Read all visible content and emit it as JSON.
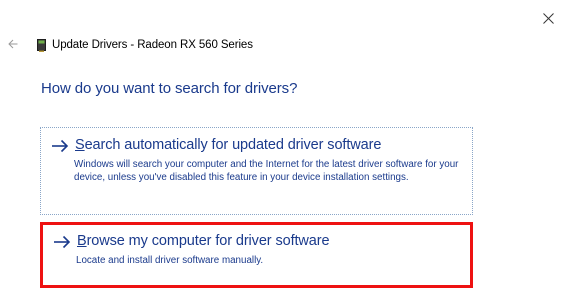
{
  "window": {
    "close_icon": "close-icon",
    "back_icon": "back-arrow-icon"
  },
  "header": {
    "title": "Update Drivers - Radeon RX 560 Series",
    "device_icon": "graphics-card-icon"
  },
  "main": {
    "question": "How do you want to search for drivers?",
    "options": [
      {
        "title_first": "S",
        "title_rest": "earch automatically for updated driver software",
        "description": "Windows will search your computer and the Internet for the latest driver software for your device, unless you've disabled this feature in your device installation settings.",
        "icon": "arrow-right-icon"
      },
      {
        "title_first": "B",
        "title_rest": "rowse my computer for driver software",
        "description": "Locate and install driver software manually.",
        "icon": "arrow-right-icon",
        "highlight_color": "#ee1111"
      }
    ]
  },
  "colors": {
    "link_blue": "#1a3a8c",
    "highlight_red": "#ee1111"
  }
}
